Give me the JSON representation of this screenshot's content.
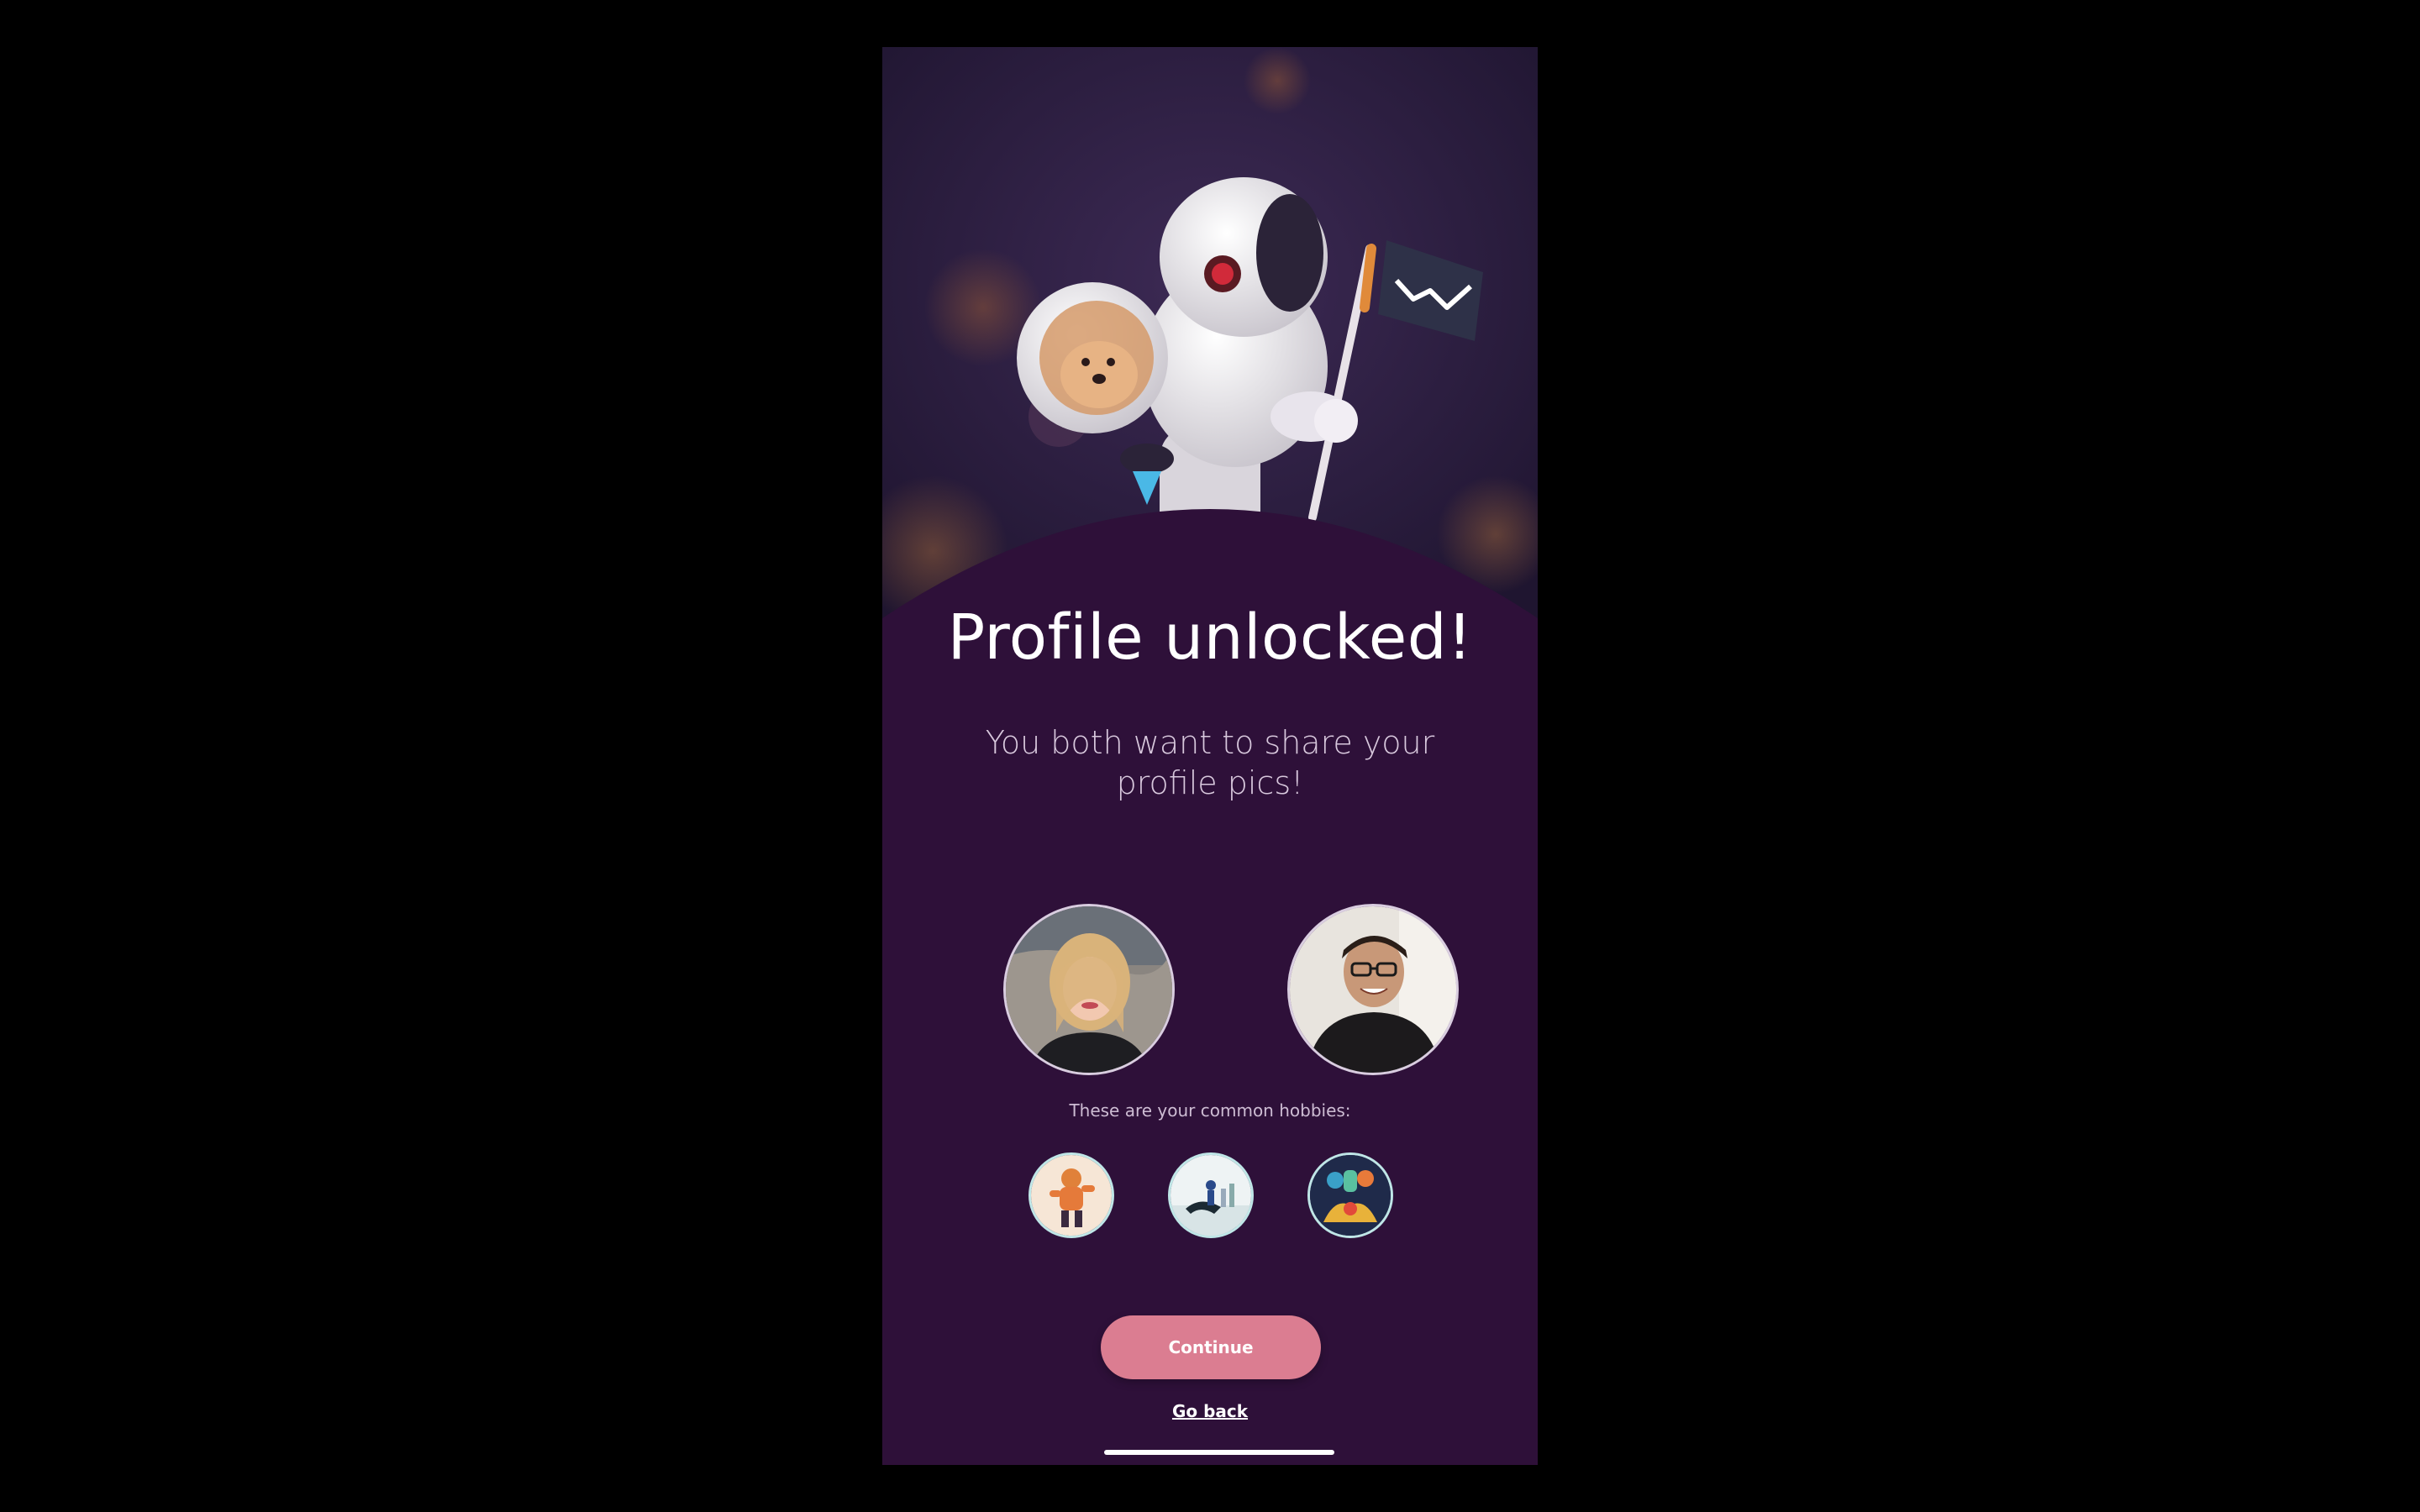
{
  "screen": {
    "title": "Profile unlocked!",
    "subtitle": "You both want to share your profile pics!",
    "hobbies_label": "These are your common hobbies:",
    "continue_label": "Continue",
    "go_back_label": "Go back"
  },
  "hero": {
    "illustration": "astronaut-with-dog-and-flag"
  },
  "profiles": [
    {
      "avatar": "woman-blonde-hair-photo"
    },
    {
      "avatar": "man-glasses-photo"
    }
  ],
  "hobbies": [
    {
      "icon": "hobby-illustration-1"
    },
    {
      "icon": "hobby-illustration-2"
    },
    {
      "icon": "hobby-illustration-3"
    }
  ],
  "colors": {
    "background": "#2e1039",
    "accent_button": "#db7d91",
    "text_primary": "#ffffff",
    "text_secondary": "#d8c8dd"
  }
}
